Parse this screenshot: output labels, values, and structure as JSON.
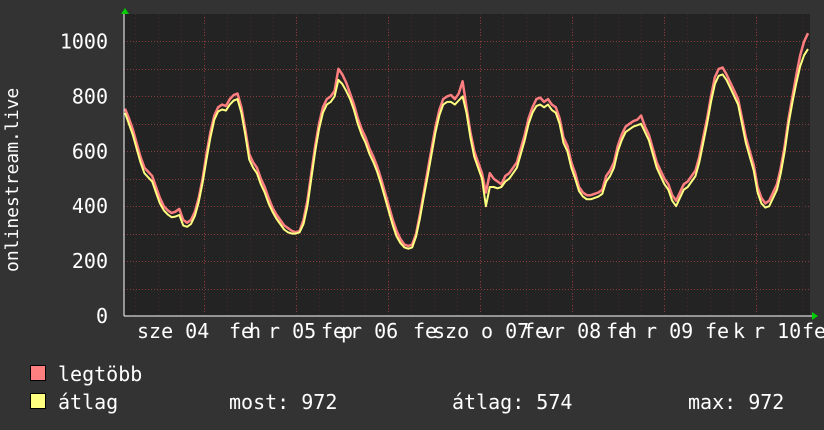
{
  "chart_data": {
    "type": "line",
    "ylabel": "onlinestream.live",
    "ylim": [
      0,
      1100
    ],
    "yticks": [
      0,
      200,
      400,
      600,
      800,
      1000
    ],
    "grid": true,
    "x_day_labels": [
      "sze 04",
      "fe",
      "h",
      "r 05",
      "fe",
      "p",
      "r 06",
      "fe",
      "szo",
      "o 07",
      "fe",
      "v",
      "r 08",
      "fe",
      "h",
      "r 09",
      "fe",
      "k",
      "r 10",
      "fe"
    ],
    "series": [
      {
        "name": "legtöbb",
        "color": "#ff7f80",
        "values": [
          755,
          720,
          680,
          630,
          580,
          540,
          525,
          510,
          470,
          430,
          400,
          385,
          375,
          380,
          390,
          350,
          340,
          350,
          380,
          430,
          500,
          590,
          670,
          730,
          760,
          770,
          765,
          790,
          805,
          810,
          760,
          680,
          590,
          560,
          540,
          500,
          470,
          430,
          395,
          370,
          350,
          330,
          320,
          310,
          305,
          310,
          350,
          420,
          520,
          620,
          700,
          760,
          790,
          800,
          820,
          900,
          880,
          850,
          810,
          770,
          720,
          680,
          650,
          610,
          580,
          545,
          500,
          450,
          400,
          350,
          310,
          280,
          260,
          255,
          260,
          300,
          370,
          450,
          530,
          610,
          690,
          750,
          790,
          800,
          805,
          790,
          810,
          855,
          760,
          670,
          600,
          560,
          520,
          450,
          520,
          500,
          490,
          480,
          510,
          520,
          540,
          560,
          610,
          660,
          720,
          760,
          790,
          795,
          780,
          790,
          770,
          760,
          720,
          650,
          620,
          560,
          520,
          470,
          450,
          440,
          440,
          445,
          450,
          460,
          510,
          530,
          560,
          620,
          660,
          690,
          700,
          710,
          715,
          730,
          690,
          660,
          610,
          560,
          530,
          500,
          480,
          440,
          420,
          450,
          480,
          490,
          510,
          530,
          580,
          650,
          720,
          800,
          870,
          900,
          905,
          880,
          850,
          820,
          790,
          720,
          650,
          600,
          550,
          470,
          430,
          410,
          420,
          450,
          480,
          540,
          620,
          720,
          800,
          880,
          950,
          1000,
          1030
        ]
      },
      {
        "name": "átlag",
        "color": "#ffff80",
        "values": [
          740,
          700,
          660,
          610,
          560,
          520,
          505,
          490,
          450,
          410,
          385,
          370,
          360,
          362,
          368,
          330,
          325,
          335,
          365,
          415,
          485,
          570,
          650,
          715,
          745,
          752,
          748,
          770,
          785,
          790,
          740,
          660,
          570,
          540,
          520,
          480,
          450,
          410,
          380,
          355,
          335,
          315,
          305,
          300,
          300,
          305,
          335,
          400,
          500,
          600,
          680,
          740,
          770,
          780,
          800,
          860,
          845,
          820,
          790,
          750,
          700,
          660,
          630,
          590,
          560,
          525,
          480,
          430,
          380,
          330,
          290,
          265,
          250,
          245,
          250,
          290,
          355,
          435,
          510,
          590,
          670,
          730,
          770,
          780,
          780,
          770,
          785,
          800,
          740,
          650,
          580,
          540,
          500,
          400,
          470,
          470,
          465,
          470,
          490,
          500,
          520,
          540,
          590,
          640,
          700,
          740,
          765,
          770,
          760,
          770,
          750,
          740,
          700,
          630,
          600,
          540,
          500,
          455,
          435,
          425,
          425,
          430,
          435,
          445,
          490,
          510,
          540,
          600,
          640,
          670,
          680,
          690,
          695,
          700,
          670,
          640,
          590,
          540,
          510,
          480,
          460,
          420,
          400,
          430,
          460,
          470,
          490,
          510,
          560,
          630,
          700,
          780,
          845,
          875,
          880,
          860,
          830,
          800,
          770,
          700,
          630,
          580,
          530,
          450,
          410,
          395,
          400,
          430,
          460,
          520,
          600,
          700,
          780,
          850,
          910,
          950,
          972
        ]
      }
    ]
  },
  "legend": {
    "max_label": "legtöbb",
    "avg_label": "átlag"
  },
  "stats": {
    "now": "most: 972",
    "avg": "átlag: 574",
    "max": "max: 972"
  },
  "colors": {
    "background": "#333333",
    "plot_background": "#232323",
    "grid": "#8a3c3c",
    "axis": "#ffffff",
    "arrow": "#00cc00",
    "series_max": "#ff7f80",
    "series_avg": "#ffff80"
  }
}
